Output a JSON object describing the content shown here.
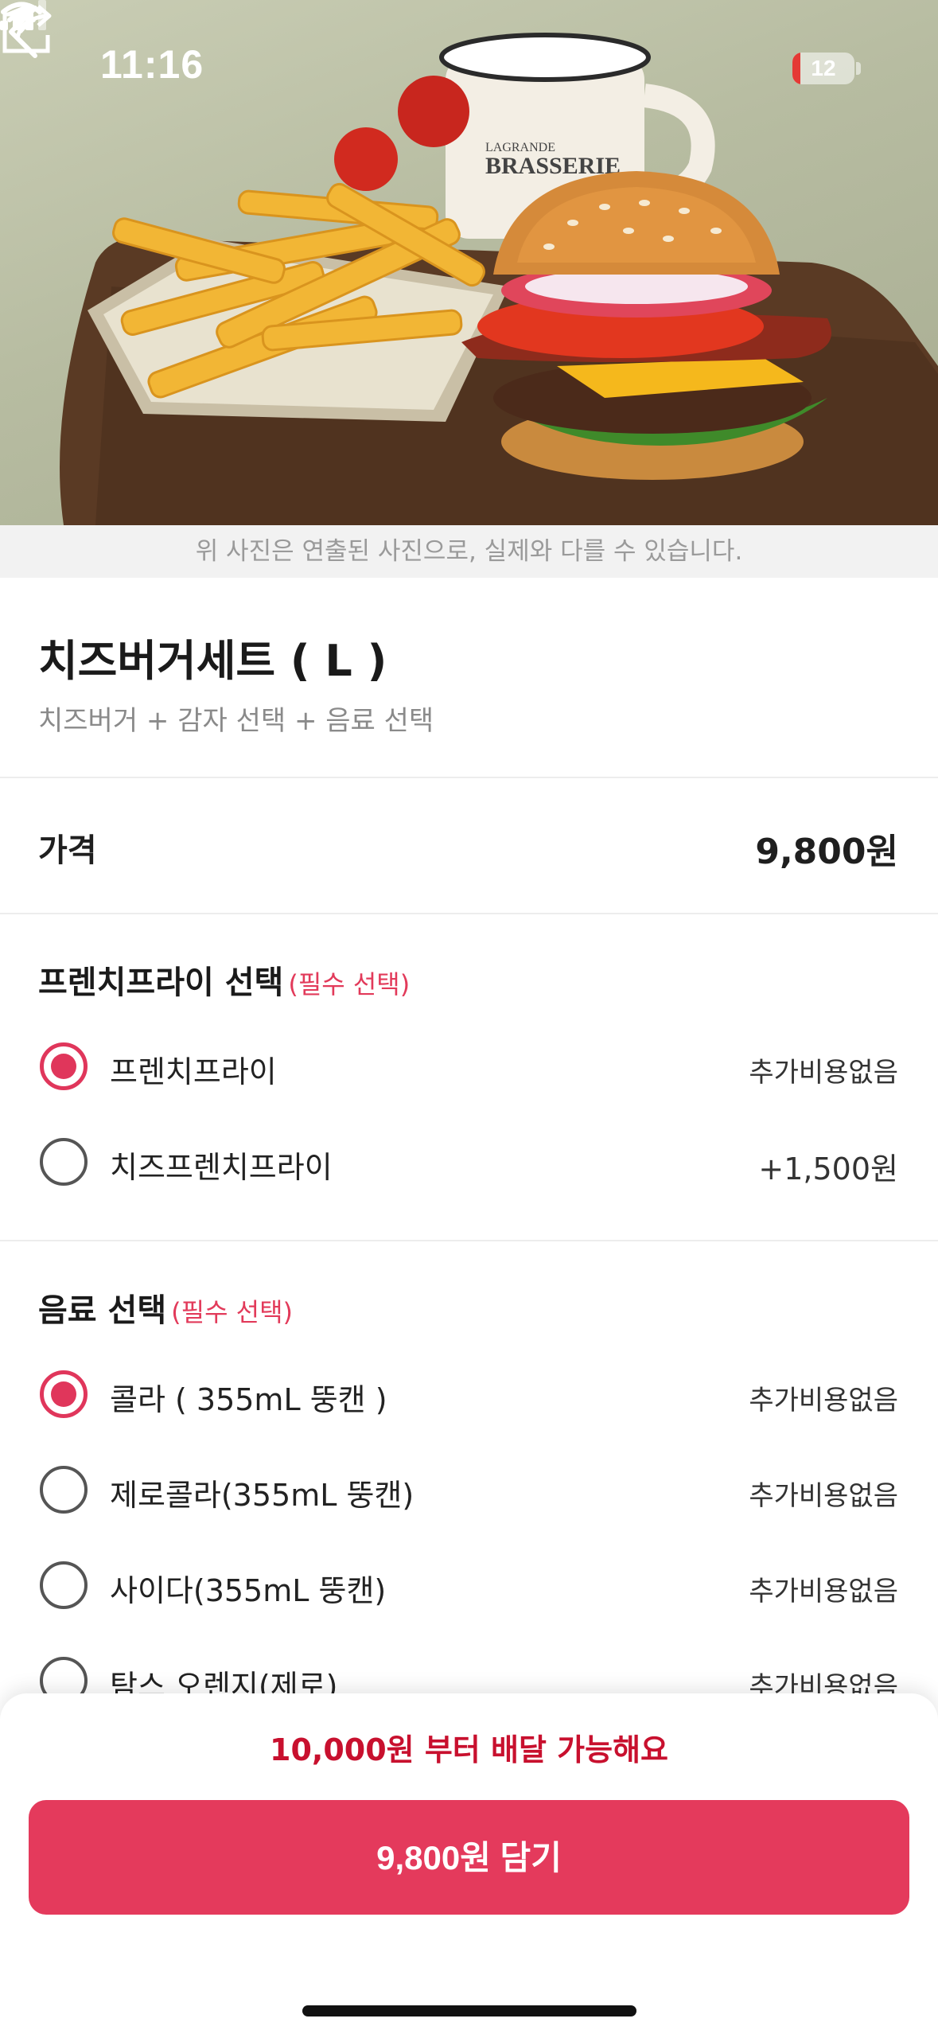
{
  "status_bar": {
    "time": "11:16",
    "battery": "12"
  },
  "hero": {
    "photo_note": "위 사진은 연출된 사진으로, 실제와 다를 수 있습니다."
  },
  "product": {
    "title": "치즈버거세트 ( L )",
    "subtitle": "치즈버거 + 감자 선택 + 음료 선택",
    "price_label": "가격",
    "price": "9,800원"
  },
  "groups": [
    {
      "title": "프렌치프라이 선택",
      "required": "(필수 선택)",
      "options": [
        {
          "label": "프렌치프라이",
          "price": "추가비용없음",
          "selected": true
        },
        {
          "label": "치즈프렌치프라이",
          "price": "+1,500원",
          "selected": false
        }
      ]
    },
    {
      "title": "음료 선택",
      "required": "(필수 선택)",
      "options": [
        {
          "label": "콜라 ( 355mL 뚱캔 )",
          "price": "추가비용없음",
          "selected": true
        },
        {
          "label": "제로콜라(355mL 뚱캔)",
          "price": "추가비용없음",
          "selected": false
        },
        {
          "label": "사이다(355mL 뚱캔)",
          "price": "추가비용없음",
          "selected": false
        },
        {
          "label": "탐스 오렌지(제로)",
          "price": "추가비용없음",
          "selected": false
        }
      ]
    }
  ],
  "bottom": {
    "delivery_note": "10,000원 부터 배달 가능해요",
    "cart_button": "9,800원 담기"
  },
  "colors": {
    "accent": "#e43a5c",
    "required": "#e23a5a",
    "delivery_note": "#c8102e"
  },
  "icons": [
    "back-arrow-icon",
    "share-icon",
    "location-arrow-icon",
    "signal-icon",
    "wifi-icon"
  ]
}
